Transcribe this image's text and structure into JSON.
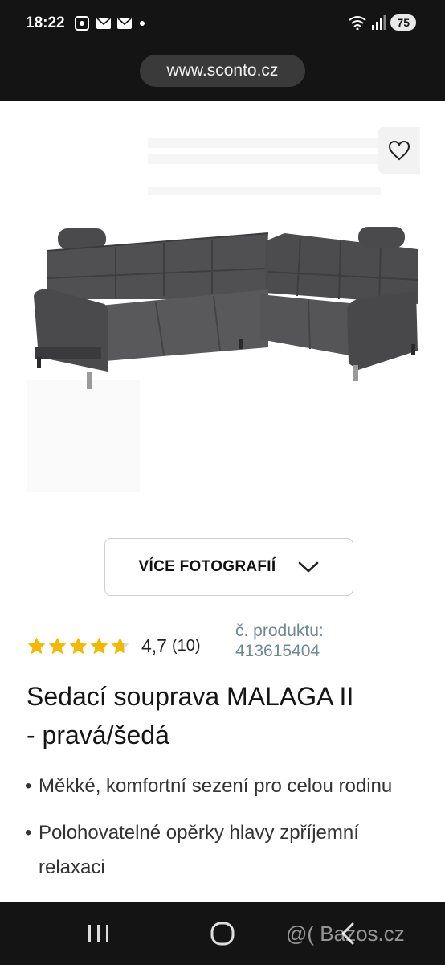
{
  "status_bar": {
    "time": "18:22",
    "battery": "75",
    "icons_left": [
      "screenshot-icon",
      "mail-icon",
      "mail-icon",
      "dot-icon"
    ],
    "icons_right": [
      "wifi-icon",
      "signal-icon"
    ]
  },
  "browser": {
    "url": "www.sconto.cz"
  },
  "product": {
    "more_photos_label": "VÍCE FOTOGRAFIÍ",
    "rating_value": "4,7",
    "rating_count": "(10)",
    "rating_stars": 4.7,
    "product_no_label": "č. produktu:",
    "product_no": "413615404",
    "title_line1": "Sedací souprava MALAGA II",
    "title_line2": "- pravá/šedá",
    "bullets": [
      "Měkké, komfortní sezení pro celou rodinu",
      "Polohovatelné opěrky hlavy zpříjemní relaxaci"
    ]
  },
  "colors": {
    "star": "#f5b800",
    "bars": "#141414",
    "product_no": "#6f8895"
  },
  "nav": {
    "icons": [
      "recent-apps-icon",
      "home-icon",
      "back-icon"
    ],
    "watermark": "@( Bazos.cz"
  }
}
